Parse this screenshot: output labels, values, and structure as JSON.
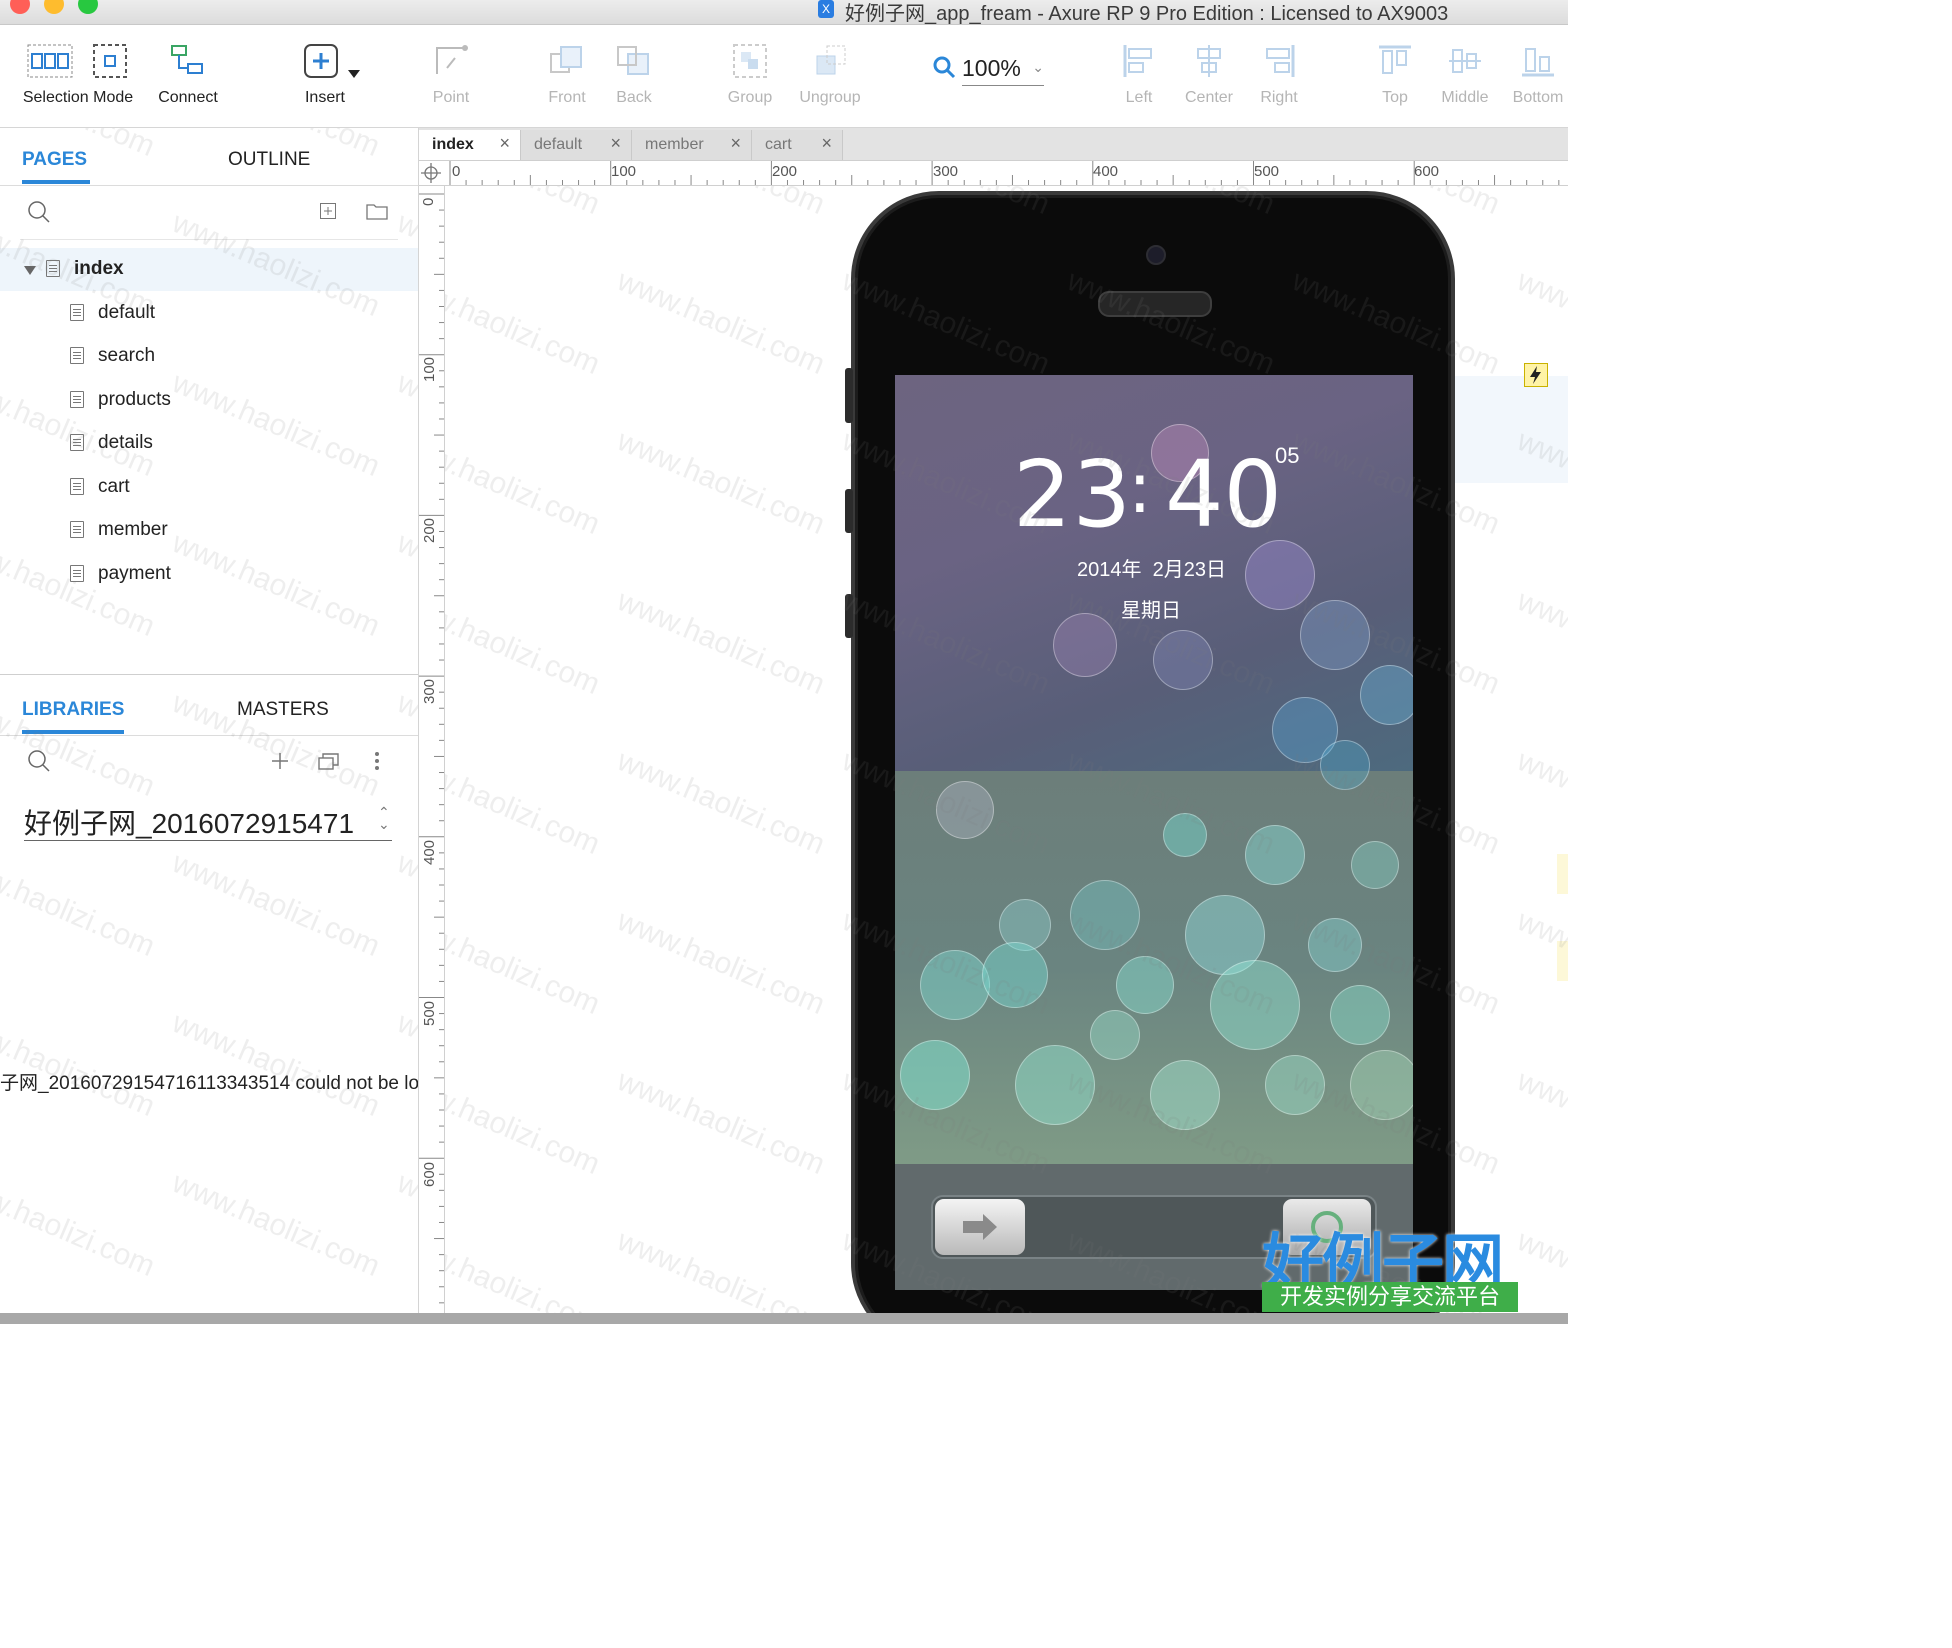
{
  "window": {
    "title": "好例子网_app_fream - Axure RP 9 Pro Edition : Licensed to AX9003",
    "app_icon": "X"
  },
  "toolbar": {
    "selection_mode": "Selection Mode",
    "connect": "Connect",
    "insert": "Insert",
    "point": "Point",
    "front": "Front",
    "back": "Back",
    "group": "Group",
    "ungroup": "Ungroup",
    "zoom": "100%",
    "left": "Left",
    "center": "Center",
    "right": "Right",
    "top": "Top",
    "middle": "Middle",
    "bottom": "Bottom"
  },
  "pages_pane": {
    "tab_pages": "PAGES",
    "tab_outline": "OUTLINE",
    "items": [
      {
        "label": "index"
      },
      {
        "label": "default"
      },
      {
        "label": "search"
      },
      {
        "label": "products"
      },
      {
        "label": "details"
      },
      {
        "label": "cart"
      },
      {
        "label": "member"
      },
      {
        "label": "payment"
      }
    ]
  },
  "libraries_pane": {
    "tab_libraries": "LIBRARIES",
    "tab_masters": "MASTERS",
    "library_select": "好例子网_2016072915471",
    "error_message": "子网_20160729154716113343514 could not be lo"
  },
  "doc_tabs": [
    {
      "label": "index"
    },
    {
      "label": "default"
    },
    {
      "label": "member"
    },
    {
      "label": "cart"
    }
  ],
  "ruler": {
    "h_labels": [
      "0",
      "100",
      "200",
      "300",
      "400",
      "500",
      "600"
    ],
    "v_labels": [
      "0",
      "100",
      "200",
      "300",
      "400",
      "500",
      "600"
    ]
  },
  "lockscreen": {
    "hours": "23",
    "separator": ":",
    "minutes": "40",
    "seconds": "05",
    "date": "2014年  2月23日",
    "weekday": "星期日"
  },
  "watermark": {
    "text": "www.haolizi.com",
    "logo_main": "好例子网",
    "logo_sub": "开发实例分享交流平台"
  },
  "colors": {
    "accent": "#2b87d8",
    "logo_blue": "#2a8be0",
    "logo_green": "#3fae49"
  }
}
